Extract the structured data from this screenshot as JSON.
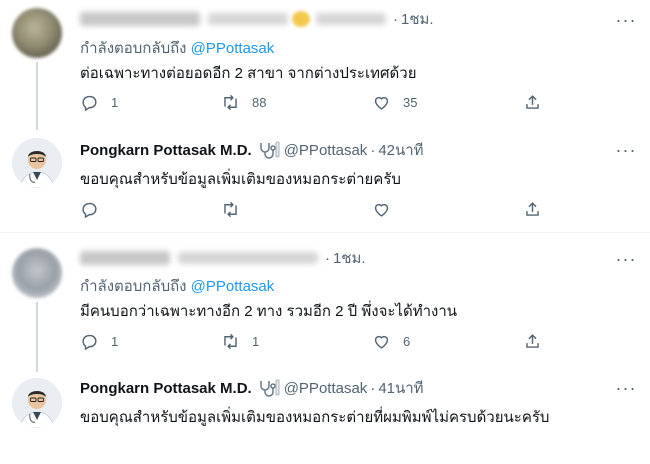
{
  "tweets": [
    {
      "time": "1ชม.",
      "replying_prefix": "กำลังตอบกลับถึง",
      "replying_to": "@PPottasak",
      "text": "ต่อเฉพาะทางต่อยอดอีก 2 สาขา จากต่างประเทศด้วย",
      "replies": "1",
      "retweets": "88",
      "likes": "35"
    },
    {
      "name": "Pongkarn Pottasak M.D.",
      "emoji": "🩺",
      "handle": "@PPottasak",
      "time": "42นาที",
      "text": "ขอบคุณสำหรับข้อมูลเพิ่มเติมของหมอกระต่ายครับ"
    },
    {
      "time": "1ชม.",
      "replying_prefix": "กำลังตอบกลับถึง",
      "replying_to": "@PPottasak",
      "text": "มีคนบอกว่าเฉพาะทางอีก 2 ทาง รวมอีก 2 ปี พึ่งจะได้ทำงาน",
      "replies": "1",
      "retweets": "1",
      "likes": "6"
    },
    {
      "name": "Pongkarn Pottasak M.D.",
      "emoji": "🩺",
      "handle": "@PPottasak",
      "time": "41นาที",
      "text": "ขอบคุณสำหรับข้อมูลเพิ่มเติมของหมอกระต่ายที่ผมพิมพ์ไม่ครบด้วยนะครับ"
    }
  ],
  "dot": "·",
  "more_glyph": "···",
  "icons": [
    "reply-icon",
    "retweet-icon",
    "like-icon",
    "share-icon",
    "more-icon",
    "stethoscope-icon",
    "doctor-avatar"
  ],
  "colors": {
    "link": "#1d9bf0",
    "secondary": "#536471",
    "text": "#0f1419",
    "line": "#cfd9de"
  }
}
